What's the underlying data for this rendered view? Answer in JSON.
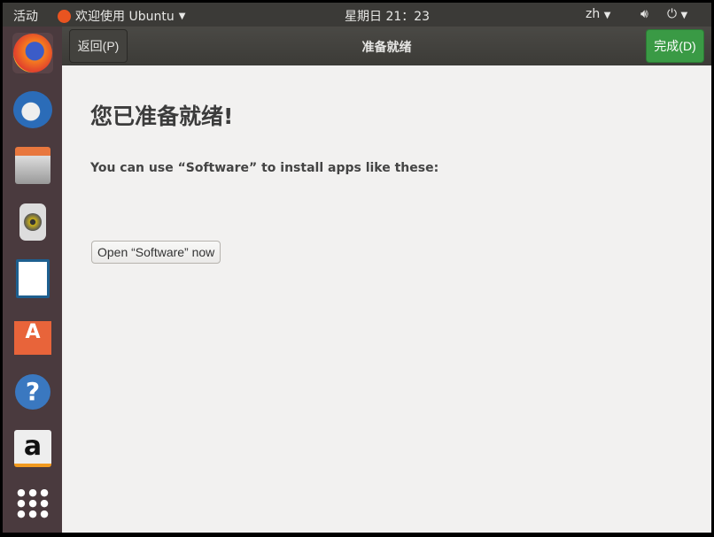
{
  "topbar": {
    "activities": "活动",
    "app_menu": "欢迎使用 Ubuntu",
    "clock": "星期日 21：23",
    "lang": "zh"
  },
  "dock": [
    "firefox",
    "thunderbird",
    "files",
    "rhythmbox",
    "libreoffice-writer",
    "software",
    "help",
    "amazon",
    "show-apps"
  ],
  "titlebar": {
    "back": "返回(P)",
    "title": "准备就绪",
    "done": "完成(D)"
  },
  "content": {
    "heading": "您已准备就绪!",
    "subtitle": "You can use “Software” to install apps like these:",
    "open_button": "Open “Software” now"
  },
  "colors": {
    "done": "#3a9a45",
    "ubuntu": "#e95420"
  }
}
